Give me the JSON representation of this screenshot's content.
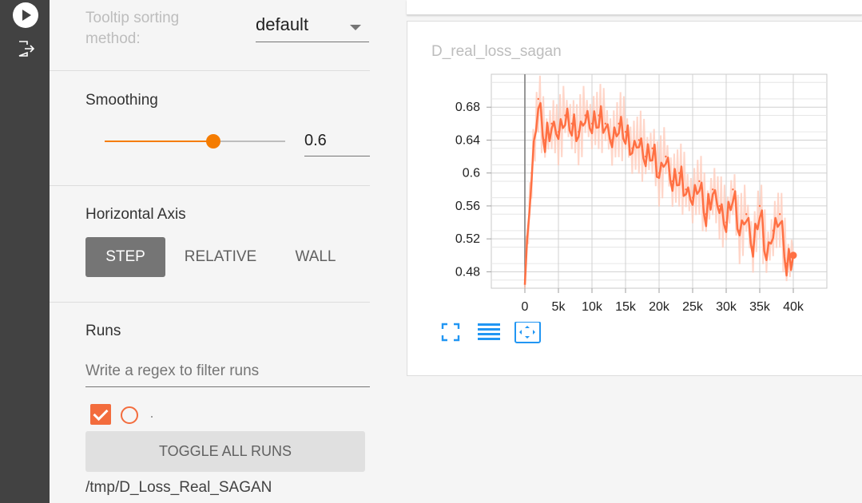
{
  "sidebar": {
    "tooltip_label": "Tooltip sorting method:",
    "tooltip_value": "default",
    "smoothing_label": "Smoothing",
    "smoothing_value": "0.6",
    "smoothing_fraction": 0.6,
    "horizontal_axis_label": "Horizontal Axis",
    "axis_buttons": [
      "STEP",
      "RELATIVE",
      "WALL"
    ],
    "runs_label": "Runs",
    "runs_placeholder": "Write a regex to filter runs",
    "toggle_all": "TOGGLE ALL RUNS",
    "run_path": "/tmp/D_Loss_Real_SAGAN"
  },
  "chart_card": {
    "title": "D_real_loss_sagan",
    "tools": [
      "fullscreen-icon",
      "list-icon",
      "fit-domain-icon"
    ]
  },
  "colors": {
    "accent": "#f57c00",
    "series": "#ff7043",
    "series_raw": "#ffccbc",
    "rail": "#424242"
  },
  "chart_data": {
    "type": "line",
    "title": "D_real_loss_sagan",
    "xlabel": "",
    "ylabel": "",
    "x_ticks": [
      "0",
      "5k",
      "10k",
      "15k",
      "20k",
      "25k",
      "30k",
      "35k",
      "40k"
    ],
    "y_ticks": [
      "0.48",
      "0.52",
      "0.56",
      "0.6",
      "0.64",
      "0.68"
    ],
    "xlim": [
      -5000,
      45000
    ],
    "ylim": [
      0.46,
      0.72
    ],
    "grid": true,
    "series": [
      {
        "x": [
          0,
          1000,
          2000,
          3000,
          4000,
          5000,
          6000,
          7000,
          8000,
          9000,
          10000,
          11000,
          12000,
          13000,
          14000,
          15000,
          16000,
          17000,
          18000,
          19000,
          20000,
          21000,
          22000,
          23000,
          24000,
          25000,
          26000,
          27000,
          28000,
          29000,
          30000,
          31000,
          32000,
          33000,
          34000,
          35000,
          36000,
          37000,
          38000,
          39000,
          40000
        ],
        "values": [
          0.47,
          0.6,
          0.69,
          0.64,
          0.66,
          0.65,
          0.67,
          0.66,
          0.65,
          0.67,
          0.66,
          0.67,
          0.66,
          0.64,
          0.66,
          0.65,
          0.63,
          0.64,
          0.62,
          0.63,
          0.6,
          0.62,
          0.59,
          0.6,
          0.58,
          0.57,
          0.59,
          0.55,
          0.58,
          0.56,
          0.54,
          0.58,
          0.53,
          0.55,
          0.51,
          0.56,
          0.5,
          0.53,
          0.55,
          0.49,
          0.5
        ]
      }
    ]
  }
}
